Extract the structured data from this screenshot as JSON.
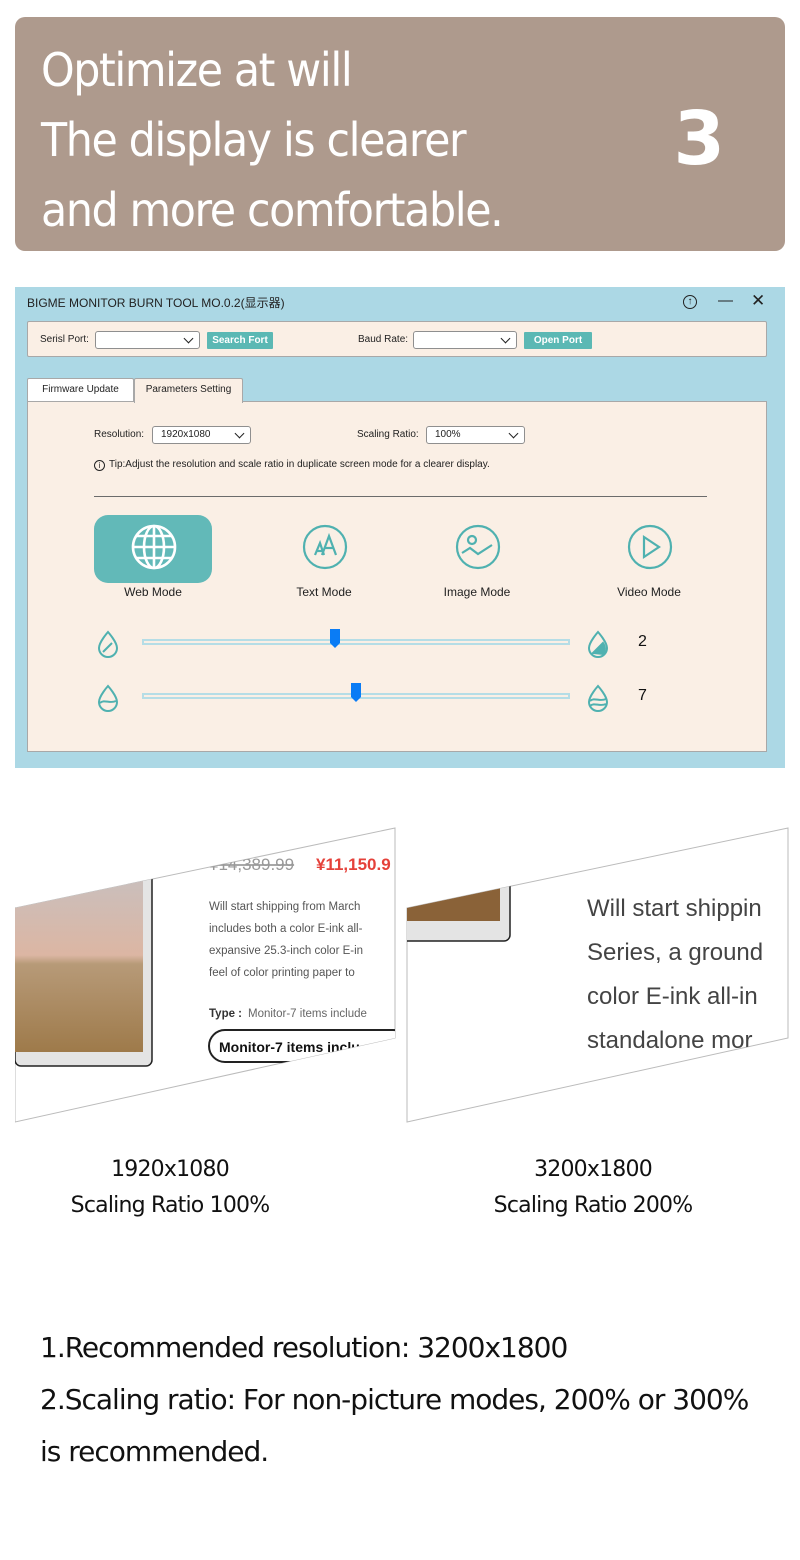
{
  "banner": {
    "lines": [
      "Optimize at will",
      "The display is clearer",
      "and more comfortable."
    ],
    "step_number": "3",
    "bg_color": "#ae9a8d"
  },
  "app": {
    "title": "BIGME MONITOR BURN TOOL MO.0.2(显示器)",
    "window_controls": [
      "pin-icon",
      "minimize-icon",
      "close-icon"
    ],
    "port_bar": {
      "serial_port_label": "Serisl Port:",
      "serial_port_value": "",
      "search_button": "Search Fort",
      "baud_rate_label": "Baud Rate:",
      "baud_rate_value": "",
      "open_button": "Open Port"
    },
    "tabs": [
      {
        "label": "Firmware Update",
        "active": false
      },
      {
        "label": "Parameters Setting",
        "active": true
      }
    ],
    "params": {
      "resolution_label": "Resolution:",
      "resolution_value": "1920x1080",
      "scaling_label": "Scaling Ratio:",
      "scaling_value": "100%",
      "tip": "Tip:Adjust the resolution and scale ratio in duplicate screen mode for a clearer display.",
      "tip_icon": "info-icon"
    },
    "modes": [
      {
        "label": "Web Mode",
        "icon": "globe-icon",
        "active": true
      },
      {
        "label": "Text Mode",
        "icon": "text-size-icon",
        "active": false
      },
      {
        "label": "Image Mode",
        "icon": "image-icon",
        "active": false
      },
      {
        "label": "Video Mode",
        "icon": "play-icon",
        "active": false
      }
    ],
    "sliders": [
      {
        "name": "contrast",
        "value": "2",
        "fill_fraction": 0.45
      },
      {
        "name": "saturation",
        "value": "7",
        "fill_fraction": 0.5
      }
    ],
    "colors": {
      "window_bg": "#acd8e5",
      "panel_bg": "#faefe5",
      "accent": "#5bb8b4",
      "slider_thumb": "#0a7cf5"
    }
  },
  "comparisons": [
    {
      "resolution": "1920x1080",
      "scaling": "Scaling Ratio 100%",
      "screen": {
        "old_price": "¥14,389.99",
        "new_price": "¥11,150.9",
        "lines": [
          "Will start shipping from March",
          "includes both a color E-ink all-",
          "expansive 25.3-inch color E-in",
          "feel of color printing paper to"
        ],
        "type_label": "Type :",
        "type_value": "Monitor-7 items include",
        "pill": "Monitor-7 items inclu"
      }
    },
    {
      "resolution": "3200x1800",
      "scaling": "Scaling Ratio 200%",
      "screen": {
        "lines": [
          "Will start shippin",
          "Series, a ground",
          "color E-ink all-in",
          "standalone mor"
        ]
      }
    }
  ],
  "notes": [
    "1.Recommended resolution: 3200x1800",
    "2.Scaling ratio: For non-picture modes, 200% or 300% is recommended."
  ]
}
